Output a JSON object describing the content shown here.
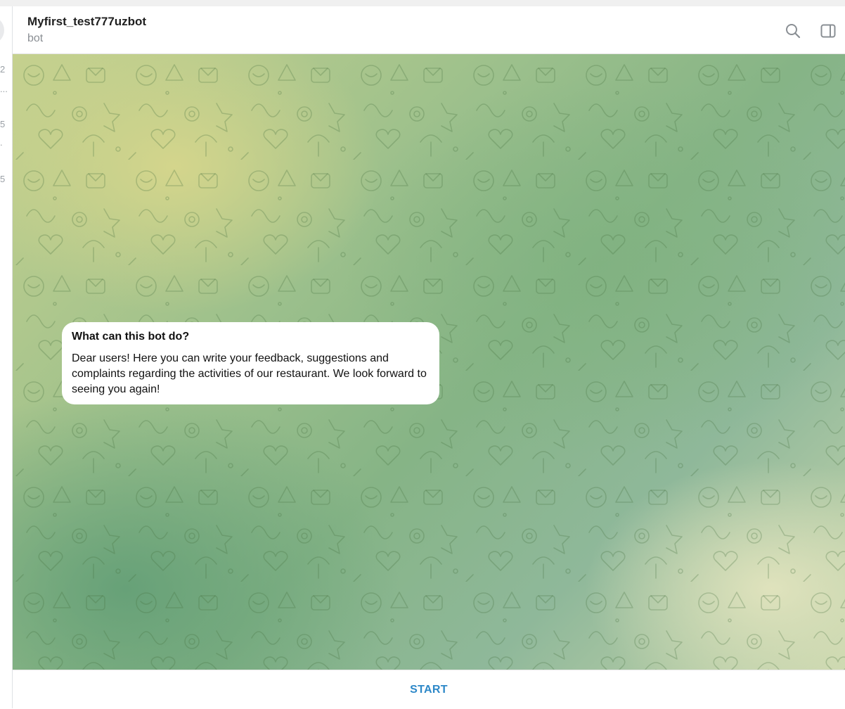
{
  "sidebar": {
    "snippets": [
      "2",
      "...",
      "5",
      ".",
      "5"
    ]
  },
  "header": {
    "title": "Myfirst_test777uzbot",
    "subtitle": "bot",
    "search_icon": "search-icon",
    "panel_icon": "sidebar-panel-icon"
  },
  "bot_info": {
    "title": "What can this bot do?",
    "description": "Dear users! Here you can write your feedback, suggestions and complaints regarding the activities of our restaurant. We look forward to seeing you again!"
  },
  "footer": {
    "start_label": "START"
  },
  "colors": {
    "accent": "#2d88c8",
    "title_text": "#1f1f1f",
    "subtitle_text": "#8b8f94"
  }
}
